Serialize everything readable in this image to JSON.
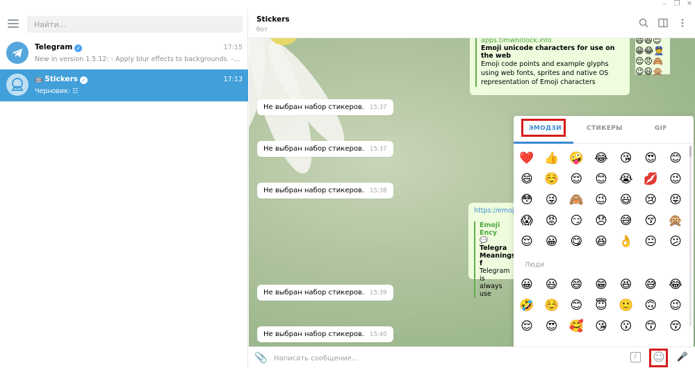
{
  "window": {
    "minimize": "–",
    "restore": "❐",
    "close": "✕"
  },
  "sidebar": {
    "search_placeholder": "Найти...",
    "chats": [
      {
        "name": "Telegram",
        "time": "17:15",
        "preview": "New in version 1.5.12: - Apply blur effects to backgrounds. - Use the...",
        "verified": true
      },
      {
        "name": "Stickers",
        "time": "17:13",
        "preview": "Черновик: ",
        "verified": true,
        "active": true
      }
    ]
  },
  "header": {
    "title": "Stickers",
    "subtitle": "бот"
  },
  "messages": [
    {
      "text": "Не выбран набор стикеров.",
      "time": "15:37"
    },
    {
      "text": "Не выбран набор стикеров.",
      "time": "15:37"
    },
    {
      "text": "Не выбран набор стикеров.",
      "time": "15:38"
    },
    {
      "text": "Не выбран набор стикеров.",
      "time": "15:39"
    },
    {
      "text": "Не выбран набор стикеров.",
      "time": "15:40"
    }
  ],
  "outgoing_1": {
    "link": "apps.timwhitlock.info",
    "title": "Emoji unicode characters for use on the web",
    "body": "Emoji code points and example glyphs using web fonts, sprites and native OS representation of Emoji characters"
  },
  "outgoing_2": {
    "link": "https://emoji",
    "title": "Emoji Ency",
    "lines": [
      "💬 Telegra",
      "Meanings f",
      "Telegram is",
      "always use"
    ]
  },
  "emoji_panel": {
    "tabs": [
      "ЭМОДЗИ",
      "СТИКЕРЫ",
      "GIF"
    ],
    "recent": [
      [
        "❤️",
        "👍",
        "🤪",
        "😂",
        "😘",
        "😍",
        "😊"
      ],
      [
        "😄",
        "☺️",
        "😌",
        "😊",
        "😭",
        "💋",
        "😉"
      ],
      [
        "😳",
        "😜",
        "🙈",
        "😉",
        "😃",
        "😢",
        "😝"
      ],
      [
        "😱",
        "😡",
        "😏",
        "😞",
        "😅",
        "😚",
        "🙊"
      ],
      [
        "😌",
        "😀",
        "😋",
        "😆",
        "👌",
        "😐",
        "😕"
      ]
    ],
    "section_label": "Люди",
    "people": [
      [
        "😀",
        "😃",
        "😄",
        "😁",
        "😆",
        "😅",
        "😂"
      ],
      [
        "🤣",
        "☺️",
        "😊",
        "😇",
        "🙂",
        "🙃",
        "😉"
      ],
      [
        "😌",
        "😍",
        "🥰",
        "😘",
        "😗",
        "😙",
        "😚"
      ]
    ],
    "categories": [
      "🕒",
      "☺",
      "🐱",
      "🍎",
      "⚽",
      "🚗",
      "💡",
      "♡"
    ]
  },
  "composer": {
    "placeholder": "Написать сообщение...",
    "slash": "/",
    "emoji": "☺",
    "mic": "🎤",
    "attach": "📎"
  },
  "colors": {
    "accent": "#419fd9",
    "highlight": "#d61b1b",
    "outgoing": "#effdde"
  }
}
